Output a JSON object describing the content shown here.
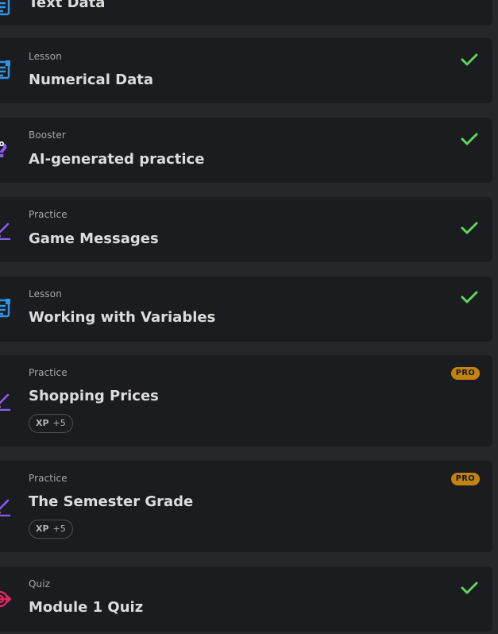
{
  "colors": {
    "page_background": "#25272b",
    "card_background": "#1b1c1f",
    "check_green": "#5fd65b",
    "pro_badge": "#c4830f",
    "lesson_icon": "#2f95e8",
    "booster_icon": "#8b5cf6",
    "practice_icon": "#8b5cf6",
    "quiz_icon": "#e0245e"
  },
  "items": [
    {
      "type": "",
      "title": "Text Data",
      "icon": "lesson-icon",
      "completed": false,
      "pro": false
    },
    {
      "type": "Lesson",
      "title": "Numerical Data",
      "icon": "lesson-icon",
      "completed": true,
      "pro": false
    },
    {
      "type": "Booster",
      "title": "AI-generated practice",
      "icon": "booster-question-icon",
      "completed": true,
      "pro": false
    },
    {
      "type": "Practice",
      "title": "Game Messages",
      "icon": "practice-pencil-icon",
      "completed": true,
      "pro": false
    },
    {
      "type": "Lesson",
      "title": "Working with Variables",
      "icon": "lesson-icon",
      "completed": true,
      "pro": false
    },
    {
      "type": "Practice",
      "title": "Shopping Prices",
      "icon": "practice-pencil-icon",
      "completed": false,
      "pro": true,
      "pro_label": "PRO",
      "xp_label": "XP",
      "xp_value": "+5"
    },
    {
      "type": "Practice",
      "title": "The Semester Grade",
      "icon": "practice-pencil-icon",
      "completed": false,
      "pro": true,
      "pro_label": "PRO",
      "xp_label": "XP",
      "xp_value": "+5"
    },
    {
      "type": "Quiz",
      "title": "Module 1 Quiz",
      "icon": "quiz-target-icon",
      "completed": true,
      "pro": false
    }
  ]
}
